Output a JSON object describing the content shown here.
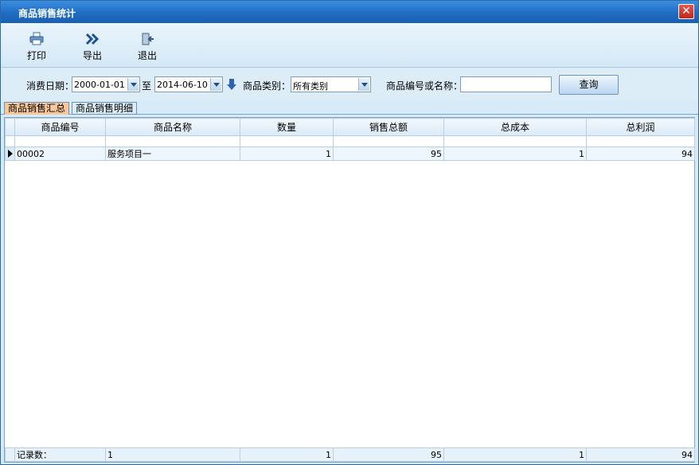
{
  "window": {
    "title": "商品销售统计",
    "close_glyph": "✕"
  },
  "toolbar": {
    "print_label": "打印",
    "export_label": "导出",
    "exit_label": "退出"
  },
  "filter": {
    "date_label": "消费日期：",
    "date_from": "2000-01-01",
    "to_label": "至",
    "date_to": "2014-06-10",
    "category_label": "商品类别：",
    "category_value": "所有类别",
    "code_name_label": "商品编号或名称：",
    "code_name_value": "",
    "query_label": "查询"
  },
  "tabs": [
    {
      "label": "商品销售汇总",
      "active": true
    },
    {
      "label": "商品销售明细",
      "active": false
    }
  ],
  "grid": {
    "columns": [
      "商品编号",
      "商品名称",
      "数量",
      "销售总额",
      "总成本",
      "总利润"
    ],
    "rows": [
      {
        "code": "00002",
        "name": "服务项目一",
        "qty": "1",
        "sales": "95",
        "cost": "1",
        "profit": "94"
      }
    ],
    "footer": {
      "label": "记录数：",
      "name": "1",
      "qty": "1",
      "sales": "95",
      "cost": "1",
      "profit": "94"
    }
  },
  "colors": {
    "title_bar": "#1f6cc4",
    "active_tab": "#f8c89a",
    "background": "#d6ebf7"
  }
}
